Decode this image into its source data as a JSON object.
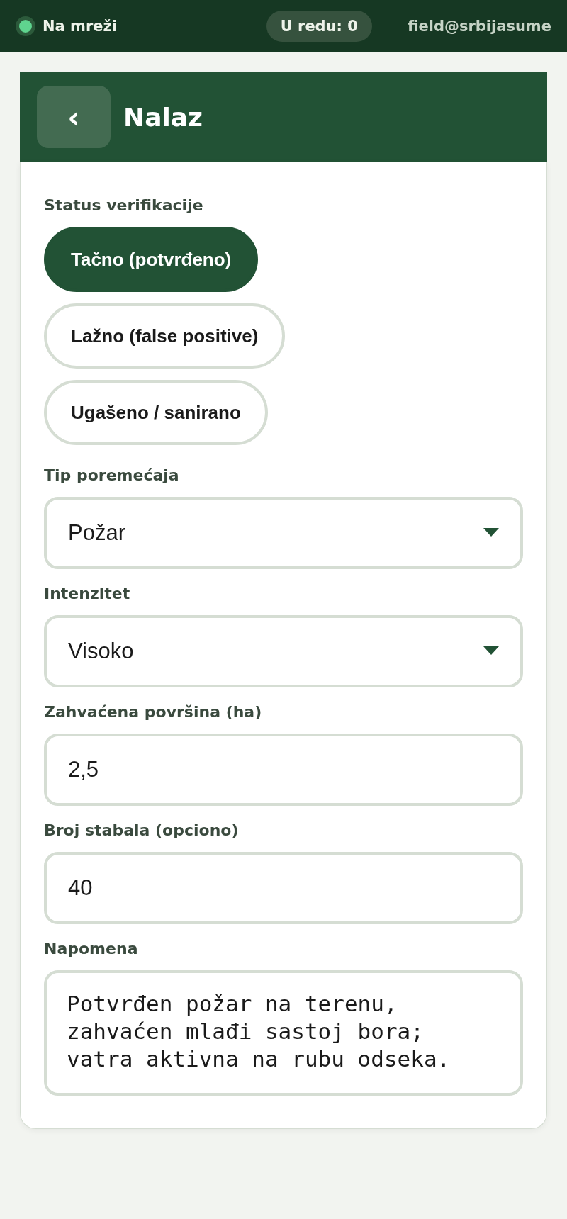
{
  "top_bar": {
    "status": {
      "label": "Na mreži",
      "online": true
    },
    "queue": "U redu: 0",
    "user": "field@srbijasume"
  },
  "header": {
    "back": "‹",
    "title": "Nalaz"
  },
  "form": {
    "status": {
      "label": "Status verifikacije",
      "options": [
        {
          "label": "Tačno (potvrđeno)",
          "selected": true
        },
        {
          "label": "Lažno (false positive)",
          "selected": false
        },
        {
          "label": "Ugašeno / sanirano",
          "selected": false
        }
      ]
    },
    "fields": [
      {
        "kind": "select",
        "label": "Tip poremećaja",
        "value": "Požar"
      },
      {
        "kind": "select",
        "label": "Intenzitet",
        "value": "Visoko"
      },
      {
        "kind": "input",
        "label": "Zahvaćena površina (ha)",
        "value": "2,5"
      },
      {
        "kind": "input",
        "label": "Broj stabala (opciono)",
        "value": "40"
      },
      {
        "kind": "textarea",
        "label": "Napomena",
        "value": "Potvrđen požar na terenu, zahvaćen mlađi sastoj bora; vatra aktivna na rubu odseka."
      }
    ]
  }
}
